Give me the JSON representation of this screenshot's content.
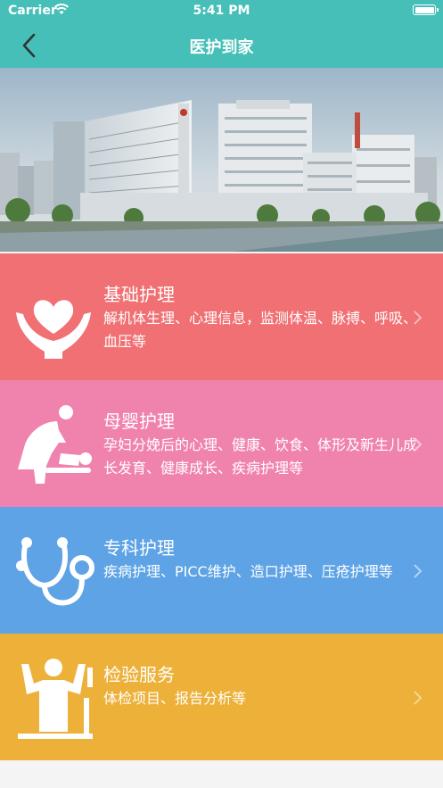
{
  "status_bar": {
    "carrier": "Carrier",
    "time": "5:41 PM"
  },
  "nav": {
    "title": "医护到家",
    "back_icon": "chevron-left-icon"
  },
  "banner": {
    "alt": "hospital-buildings-photo"
  },
  "services": [
    {
      "title": "基础护理",
      "description": "解机体生理、心理信息，监测体温、脉搏、呼吸、血压等",
      "icon": "heart-hands-icon",
      "color": "#f07073"
    },
    {
      "title": "母婴护理",
      "description": "孕妇分娩后的心理、健康、饮食、体形及新生儿成长发育、健康成长、疾病护理等",
      "icon": "mother-baby-icon",
      "color": "#f083ae"
    },
    {
      "title": "专科护理",
      "description": "疾病护理、PICC维护、造口护理、压疮护理等",
      "icon": "stethoscope-icon",
      "color": "#5da3e6"
    },
    {
      "title": "检验服务",
      "description": "体检项目、报告分析等",
      "icon": "person-height-scale-icon",
      "color": "#edb13a"
    }
  ]
}
